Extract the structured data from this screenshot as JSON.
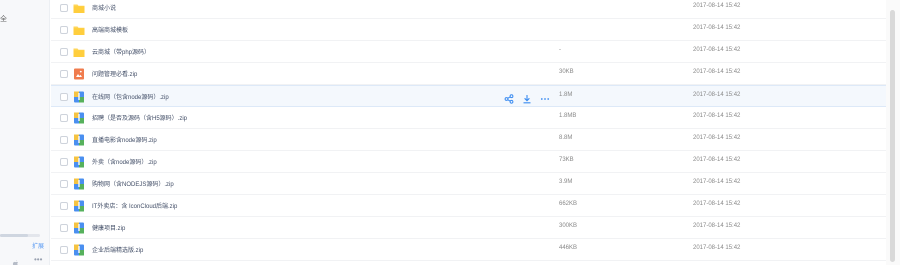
{
  "sidebar": {
    "fragment": "全",
    "expand_label": "扩展",
    "quota_fraction": 0.7
  },
  "files": [
    {
      "name": "商城小说",
      "type": "folder",
      "size": "",
      "time": "2017-08-14 15:42"
    },
    {
      "name": "高端商城模板",
      "type": "folder",
      "size": "",
      "time": "2017-08-14 15:42"
    },
    {
      "name": "云商城（带php源码）",
      "type": "folder",
      "size": "-",
      "time": "2017-08-14 15:42"
    },
    {
      "name": "问题管理必看.zip",
      "type": "image",
      "size": "30KB",
      "time": "2017-08-14 15:42"
    },
    {
      "name": "在线网（包含node源码）.zip",
      "type": "zip",
      "size": "1.8M",
      "time": "2017-08-14 15:42",
      "hover": true
    },
    {
      "name": "招聘（是否及源码（含H5源码）.zip",
      "type": "zip",
      "size": "1.8MB",
      "time": "2017-08-14 15:42"
    },
    {
      "name": "直播电影含node源码.zip",
      "type": "zip",
      "size": "8.8M",
      "time": "2017-08-14 15:42"
    },
    {
      "name": "外卖（含node源码）.zip",
      "type": "zip",
      "size": "73KB",
      "time": "2017-08-14 15:42"
    },
    {
      "name": "购物网（含NODEJS源码）.zip",
      "type": "zip",
      "size": "3.9M",
      "time": "2017-08-14 15:42"
    },
    {
      "name": "IT外卖店：含 IconCloud后端.zip",
      "type": "zip",
      "size": "662KB",
      "time": "2017-08-14 15:42"
    },
    {
      "name": "健康项目.zip",
      "type": "zip",
      "size": "300KB",
      "time": "2017-08-14 15:42"
    },
    {
      "name": "企业后端精选版.zip",
      "type": "zip",
      "size": "446KB",
      "time": "2017-08-14 15:42"
    }
  ],
  "row_actions": [
    "share-icon",
    "download-icon",
    "more-icon"
  ],
  "colors": {
    "folder": "#ffd659",
    "image": "#f07c4e",
    "zip_a": "#4a8ff0",
    "zip_b": "#f5c342",
    "zip_c": "#56b15c",
    "accent": "#3b8cf1"
  }
}
